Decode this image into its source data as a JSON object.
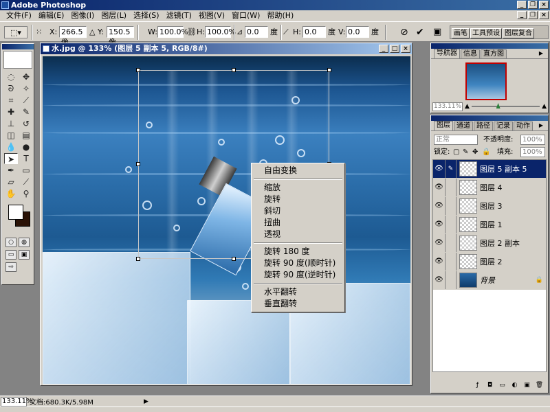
{
  "app": {
    "title": "Adobe Photoshop"
  },
  "menu": [
    "文件(F)",
    "编辑(E)",
    "图像(I)",
    "图层(L)",
    "选择(S)",
    "滤镜(T)",
    "视图(V)",
    "窗口(W)",
    "帮助(H)"
  ],
  "options": {
    "x_label": "X:",
    "x_value": "266.5 像",
    "y_label": "Y:",
    "y_value": "150.5 像",
    "w_label": "W:",
    "w_value": "100.0%",
    "h_label": "H:",
    "h_value": "100.0%",
    "angle_value": "0.0",
    "angle_unit": "度",
    "hskew_label": "H:",
    "hskew_value": "0.0",
    "hskew_unit": "度",
    "vskew_label": "V:",
    "vskew_value": "0.0",
    "vskew_unit": "度",
    "palette_tabs": [
      "画笔",
      "工具预设",
      "图层复合"
    ]
  },
  "document": {
    "title": "水.jpg @ 133% (图层 5 副本 5, RGB/8#)"
  },
  "context_menu": {
    "items": [
      "自由变换",
      "缩放",
      "旋转",
      "斜切",
      "扭曲",
      "透视",
      "旋转 180 度",
      "旋转 90 度(顺时针)",
      "旋转 90 度(逆时针)",
      "水平翻转",
      "垂直翻转"
    ]
  },
  "navigator": {
    "tabs": [
      "导航器",
      "信息",
      "直方图"
    ],
    "zoom": "133.11%"
  },
  "layers": {
    "tabs": [
      "图层",
      "通道",
      "路径",
      "记录",
      "动作"
    ],
    "blend_mode": "正常",
    "opacity_label": "不透明度:",
    "opacity_value": "100%",
    "lock_label": "锁定:",
    "fill_label": "填充:",
    "fill_value": "100%",
    "list": [
      {
        "name": "图层 5 副本 5",
        "selected": true
      },
      {
        "name": "图层 4",
        "selected": false
      },
      {
        "name": "图层 3",
        "selected": false
      },
      {
        "name": "图层 1",
        "selected": false
      },
      {
        "name": "图层 2 副本",
        "selected": false
      },
      {
        "name": "图层 2",
        "selected": false
      },
      {
        "name": "背景",
        "selected": false
      }
    ]
  },
  "status": {
    "zoom": "133.11%",
    "doc_size": "文档:680.3K/5.98M"
  }
}
